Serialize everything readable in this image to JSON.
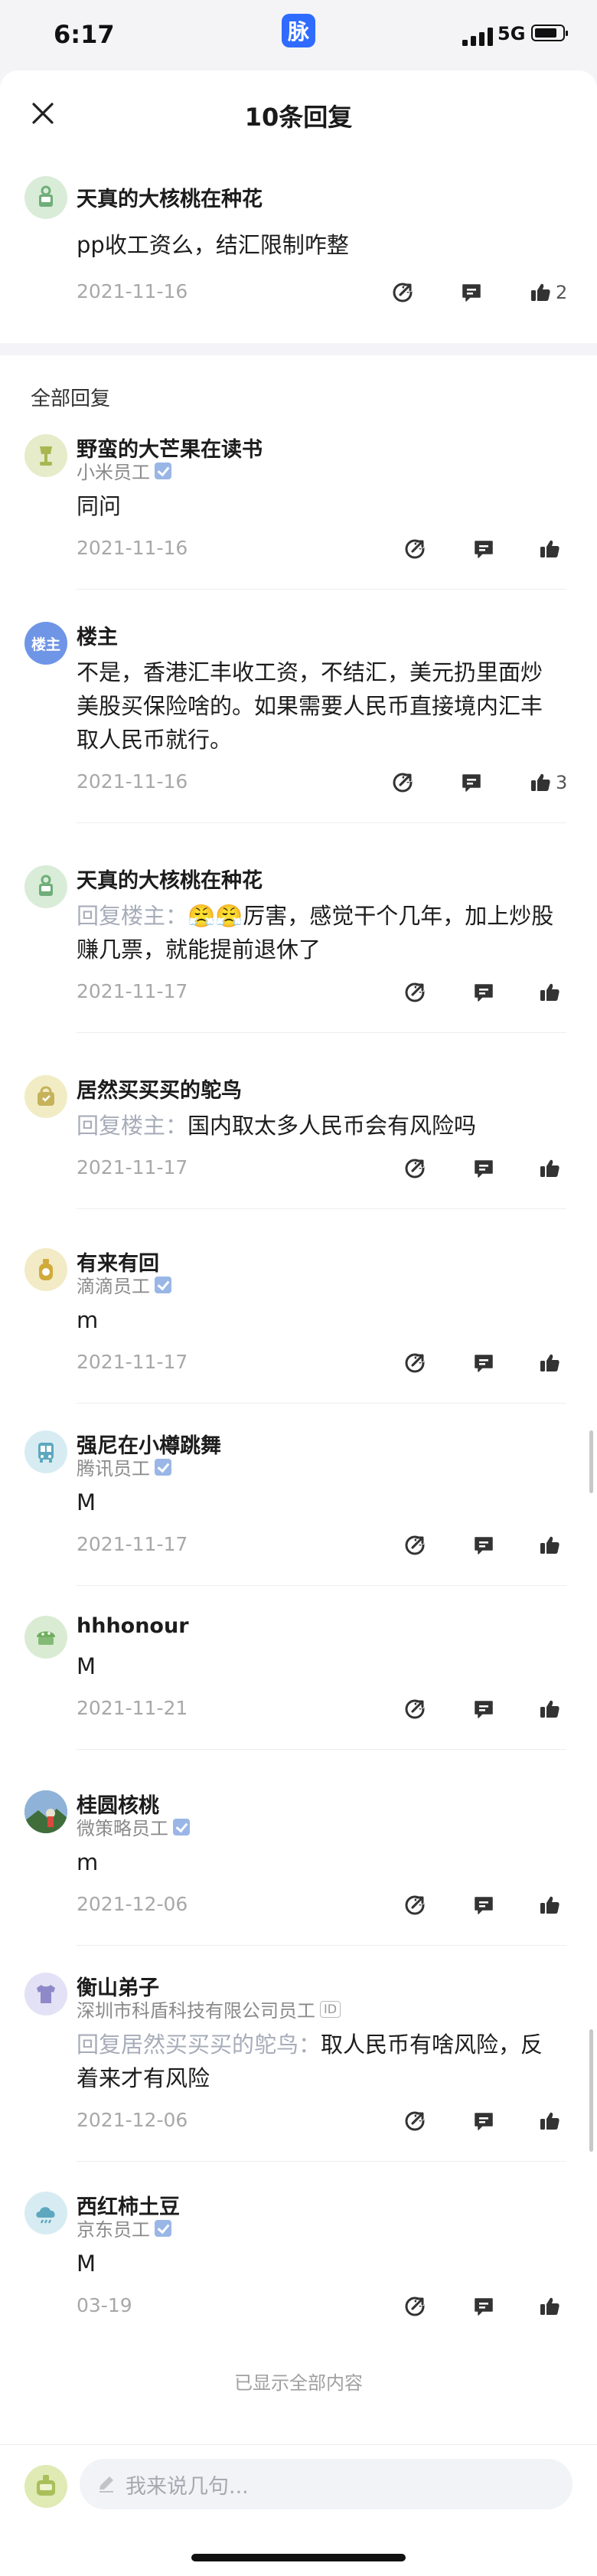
{
  "status": {
    "time": "6:17",
    "app_badge": "脉",
    "network": "5G"
  },
  "header": {
    "title": "10条回复"
  },
  "top_comment": {
    "name": "天真的大核桃在种花",
    "text": "pp收工资么，结汇限制咋整",
    "date": "2021-11-16",
    "likes": "2"
  },
  "section_title": "全部回复",
  "replies": [
    {
      "name": "野蛮的大芒果在读书",
      "sub": "小米员工",
      "text": "同问",
      "date": "2021-11-16",
      "likes": ""
    },
    {
      "name": "楼主",
      "avatar_label": "楼主",
      "sub": "",
      "text": "不是，香港汇丰收工资，不结汇，美元扔里面炒美股买保险啥的。如果需要人民币直接境内汇丰取人民币就行。",
      "date": "2021-11-16",
      "likes": "3"
    },
    {
      "name": "天真的大核桃在种花",
      "sub": "",
      "reply_prefix": "回复楼主：",
      "emoji": "😤😤",
      "text": "厉害，感觉干个几年，加上炒股赚几票，就能提前退休了",
      "date": "2021-11-17",
      "likes": ""
    },
    {
      "name": "居然买买买的鸵鸟",
      "sub": "",
      "reply_prefix": "回复楼主：",
      "text": "国内取太多人民币会有风险吗",
      "date": "2021-11-17",
      "likes": ""
    },
    {
      "name": "有来有回",
      "sub": "滴滴员工",
      "text": "m",
      "date": "2021-11-17",
      "likes": ""
    },
    {
      "name": "强尼在小樽跳舞",
      "sub": "腾讯员工",
      "text": "M",
      "date": "2021-11-17",
      "likes": ""
    },
    {
      "name": "hhhonour",
      "sub": "",
      "text": "M",
      "date": "2021-11-21",
      "likes": ""
    },
    {
      "name": "桂圆核桃",
      "sub": "微策略员工",
      "text": "m",
      "date": "2021-12-06",
      "likes": ""
    },
    {
      "name": "衡山弟子",
      "sub": "深圳市科盾科技有限公司员工",
      "id_tag": "ID",
      "reply_prefix": "回复居然买买买的鸵鸟：",
      "text": "取人民币有啥风险，反着来才有风险",
      "date": "2021-12-06",
      "likes": ""
    },
    {
      "name": "西红柿土豆",
      "sub": "京东员工",
      "text": "M",
      "date": "03-19",
      "likes": ""
    }
  ],
  "footer_note": "已显示全部内容",
  "composer": {
    "placeholder": "我来说几句..."
  },
  "icons": [
    "close-icon",
    "share-icon",
    "comment-icon",
    "like-icon",
    "pencil-icon",
    "verified-icon"
  ],
  "colors": {
    "accent": "#2f6bff",
    "reply_prefix": "#a7acb9",
    "date": "#a8a8a8"
  }
}
